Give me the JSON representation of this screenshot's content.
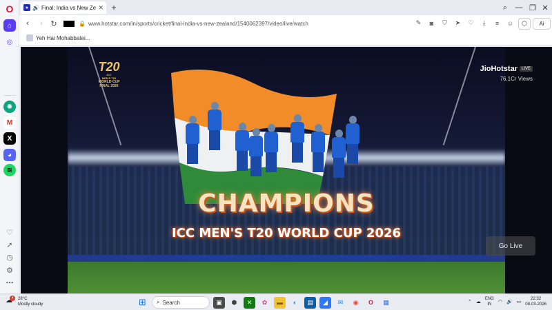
{
  "browser": {
    "tab_title": "Final: India vs New Ze",
    "url": "www.hotstar.com/in/sports/cricket/final-india-vs-new-zealand/1540062397/video/live/watch",
    "ai_label": "Ai",
    "bookmark_label": "Yeh Hai Mohabbatei..."
  },
  "video": {
    "logo_big": "T20",
    "logo_line1": "ICC",
    "logo_line2": "MEN'S T20",
    "logo_line3": "WORLD CUP",
    "logo_final": "FINAL 2026",
    "headline": "CHAMPIONS",
    "subheadline": "ICC MEN'S T20 WORLD CUP 2026",
    "brand": "JioHotstar",
    "live_badge": "LIVE",
    "views": "76.1Cr Views",
    "go_live": "Go Live"
  },
  "taskbar": {
    "badge_count": "4",
    "temperature": "28°C",
    "weather": "Mostly cloudy",
    "search_label": "Search",
    "lang_line1": "ENG",
    "lang_line2": "IN",
    "time": "22:32",
    "date": "08-03-2026"
  },
  "colors": {
    "accent": "#5a3cf0",
    "opera_red": "#e0143b",
    "jersey_blue": "#2060d0",
    "champions_glow": "#e66a2b"
  }
}
